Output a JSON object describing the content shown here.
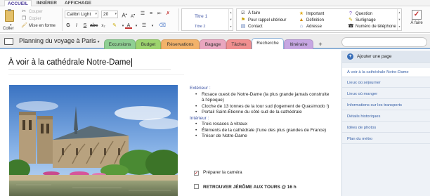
{
  "ribbon": {
    "tabs": [
      "ACCUEIL",
      "INSÉRER",
      "AFFICHAGE"
    ],
    "paste_label": "Coller",
    "cut_label": "Couper",
    "copy_label": "Copier",
    "format_painter_label": "Mise en forme",
    "font_name": "Calibri Light",
    "font_size": "20",
    "styles": {
      "title1": "Titre 1",
      "title2": "Titre 2"
    },
    "tags": {
      "todo": "À faire",
      "reminder": "Pour rappel ultérieur",
      "contact": "Contact",
      "important": "Important",
      "definition": "Définition",
      "address": "Adresse",
      "question": "Question",
      "highlight": "Surlignage",
      "phone": "Numéro de téléphone"
    },
    "todo_tag_label": "À faire"
  },
  "notebook": {
    "title": "Planning du voyage à Paris",
    "sections": [
      "Excursions",
      "Budget",
      "Réservations",
      "Bagage",
      "Tâches",
      "Recherche",
      "Itinéraire"
    ],
    "section_colors": [
      "#8fcf93",
      "#9dd36e",
      "#f2b26a",
      "#e9a6bf",
      "#f08f8f",
      "#ffffff",
      "#c6a6e2"
    ],
    "active_section": "Recherche"
  },
  "page": {
    "title": "À voir à la cathédrale Notre-Dame",
    "exterior_heading": "Extérieur :",
    "exterior_items": [
      "Rosace ouest de Notre-Dame (la plus grande jamais construite à l'époque)",
      "Cloche de 13 tonnes de la tour sud (logement de Quasimodo !)",
      "Portail Saint-Étienne du côté sud de la cathédrale"
    ],
    "interior_heading": "Intérieur :",
    "interior_items": [
      "Trois rosaces à vitraux",
      "Éléments de la cathédrale (l'une des plus grandes de France)",
      "Trésor de Notre-Dame"
    ],
    "todo1": "Préparer la caméra",
    "todo1_checked": true,
    "todo2": "RETROUVER JÉRÔME AUX TOURS @ 16 h",
    "todo2_checked": false
  },
  "pages_panel": {
    "add_page": "Ajouter une page",
    "items": [
      "À voir à la cathédrale Notre-Dame",
      "Lieux où séjourner",
      "Lieux où manger",
      "Informations sur les transports",
      "Détails historiques",
      "Idées de photos",
      "Plan du métro"
    ]
  }
}
